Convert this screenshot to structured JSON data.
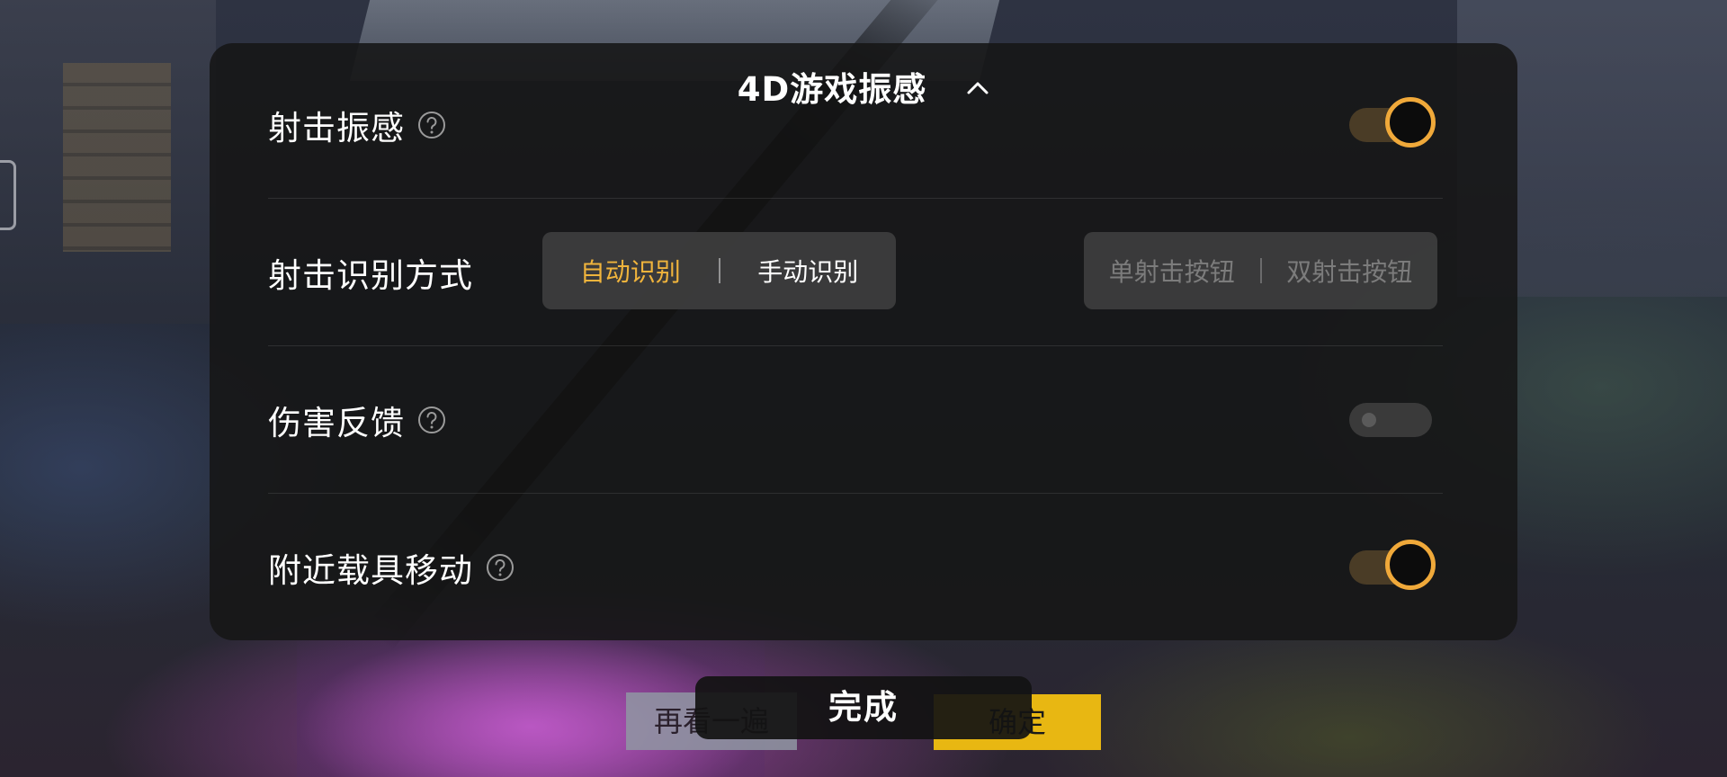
{
  "background": {
    "left_button_label": "再看一遍",
    "right_button_label": "确定"
  },
  "panel": {
    "title": "4D游戏振感",
    "collapse_icon": "chevron-up-icon",
    "rows": [
      {
        "label": "射击振感",
        "help_icon": "question-circle-icon",
        "toggle_on": true
      },
      {
        "label": "射击识别方式",
        "recognition_segment": {
          "options": [
            "自动识别",
            "手动识别"
          ],
          "selected": "自动识别"
        },
        "button_segment": {
          "options": [
            "单射击按钮",
            "双射击按钮"
          ],
          "enabled": false
        }
      },
      {
        "label": "伤害反馈",
        "help_icon": "question-circle-icon",
        "toggle_on": false
      },
      {
        "label": "附近载具移动",
        "help_icon": "question-circle-icon",
        "toggle_on": true
      }
    ]
  },
  "footer": {
    "done_label": "完成"
  },
  "colors": {
    "accent": "#f0a93a",
    "active_text": "#f0b43c",
    "panel_bg": "#161616"
  }
}
